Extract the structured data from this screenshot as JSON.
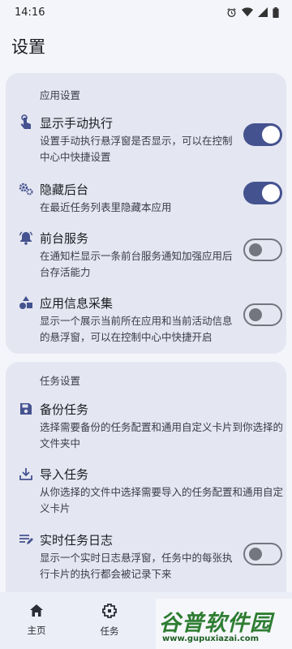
{
  "status_bar": {
    "time": "14:16",
    "icons": [
      "alarm-icon",
      "wifi-icon",
      "signal-icon",
      "battery-icon"
    ]
  },
  "page": {
    "title": "设置"
  },
  "sections": [
    {
      "title": "应用设置",
      "items": [
        {
          "title": "显示手动执行",
          "description": "设置手动执行悬浮窗是否显示，可以在控制中心中快捷设置",
          "icon": "touch-icon",
          "toggle": true
        },
        {
          "title": "隐藏后台",
          "description": "在最近任务列表里隐藏本应用",
          "icon": "gears-icon",
          "toggle": true
        },
        {
          "title": "前台服务",
          "description": "在通知栏显示一条前台服务通知加强应用后台存活能力",
          "icon": "bell-icon",
          "toggle": false
        },
        {
          "title": "应用信息采集",
          "description": "显示一个展示当前所在应用和当前活动信息的悬浮窗，可以在控制中心中快捷开启",
          "icon": "shapes-icon",
          "toggle": false
        }
      ]
    },
    {
      "title": "任务设置",
      "items": [
        {
          "title": "备份任务",
          "description": "选择需要备份的任务配置和通用自定义卡片到你选择的文件夹中",
          "icon": "save-icon"
        },
        {
          "title": "导入任务",
          "description": "从你选择的文件中选择需要导入的任务配置和通用自定义卡片",
          "icon": "download-icon"
        },
        {
          "title": "实时任务日志",
          "description": "显示一个实时日志悬浮窗，任务中的每张执行卡片的执行都会被记录下来",
          "icon": "log-icon",
          "toggle": false
        }
      ]
    }
  ],
  "bottom_nav": [
    {
      "label": "主页",
      "icon": "home-icon"
    },
    {
      "label": "任务",
      "icon": "task-icon"
    }
  ],
  "watermark": {
    "text": "谷普软件园",
    "url": "www.gupuxiazai.com"
  },
  "colors": {
    "accent": "#44528f",
    "card": "#e4e6f1",
    "background": "#f4f5fb"
  }
}
